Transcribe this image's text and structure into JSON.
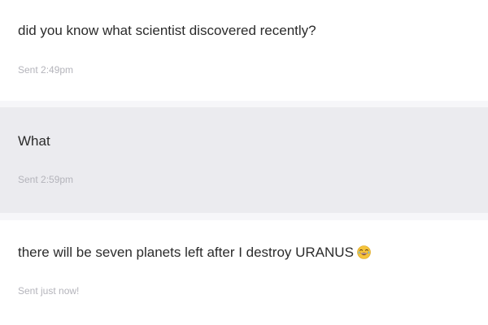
{
  "messages": [
    {
      "text": "did you know what scientist discovered recently?",
      "status": "Sent 2:49pm"
    },
    {
      "text": "What",
      "status": "Sent 2:59pm"
    },
    {
      "text": "there will be seven planets left after I destroy URANUS",
      "status": "Sent just now!",
      "emoji": "laughing-tears-emoji"
    }
  ],
  "colors": {
    "highlight_row": "#ebebef",
    "separator": "#f6f6f9",
    "text": "#2b2b2b",
    "meta": "#b4b4bb",
    "emoji_face": "#f5c33b"
  }
}
